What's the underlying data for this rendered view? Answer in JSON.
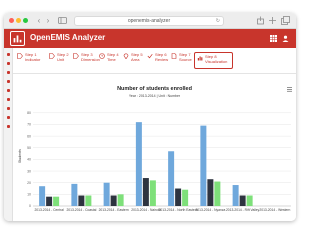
{
  "browser": {
    "url": "openemis-analyzer",
    "back_icon": "chevron-left-icon",
    "forward_icon": "chevron-right-icon"
  },
  "app": {
    "title": "OpenEMIS Analyzer",
    "brand_color": "#c8352c"
  },
  "wizard": {
    "steps": [
      {
        "label_1": "Step 1",
        "label_2": "Indicator",
        "icon": "tag-icon"
      },
      {
        "label_1": "Step 2",
        "label_2": "Unit",
        "icon": "tag-icon"
      },
      {
        "label_1": "Step 3",
        "label_2": "Dimension",
        "icon": "tag-icon"
      },
      {
        "label_1": "Step 4",
        "label_2": "Time",
        "icon": "clock-icon"
      },
      {
        "label_1": "Step 5",
        "label_2": "Area",
        "icon": "map-marker-icon"
      },
      {
        "label_1": "Step 6",
        "label_2": "Review",
        "icon": "check-icon"
      },
      {
        "label_1": "Step 7",
        "label_2": "Source",
        "icon": "file-icon"
      },
      {
        "label_1": "Step 8",
        "label_2": "Visualization",
        "icon": "chart-icon",
        "active": true
      }
    ]
  },
  "chart_data": {
    "type": "bar",
    "title": "Number of students enrolled",
    "subtitle": "Year : 2013-2014 | Unit : Number",
    "ylabel": "Students",
    "ylim": [
      0,
      85
    ],
    "yticks": [
      0,
      10,
      20,
      30,
      40,
      50,
      60,
      70,
      80
    ],
    "grid": true,
    "categories": [
      "2013-2014 - Central",
      "2013-2014 - Coastal",
      "2013-2014 - Eastern",
      "2013-2014 - Nairobi",
      "2013-2014 - North Eastern",
      "2013-2014 - Nyanza",
      "2013-2014 - Rift Valley",
      "2013-2014 - Western"
    ],
    "series": [
      {
        "color": "#6fa8dc",
        "values": [
          17,
          19,
          20,
          72,
          47,
          69,
          18,
          0
        ]
      },
      {
        "color": "#2e3440",
        "values": [
          8,
          9,
          9,
          24,
          15,
          23,
          9,
          0
        ]
      },
      {
        "color": "#7ee07a",
        "values": [
          8,
          9,
          10,
          22,
          14,
          21,
          9,
          0
        ]
      }
    ]
  }
}
